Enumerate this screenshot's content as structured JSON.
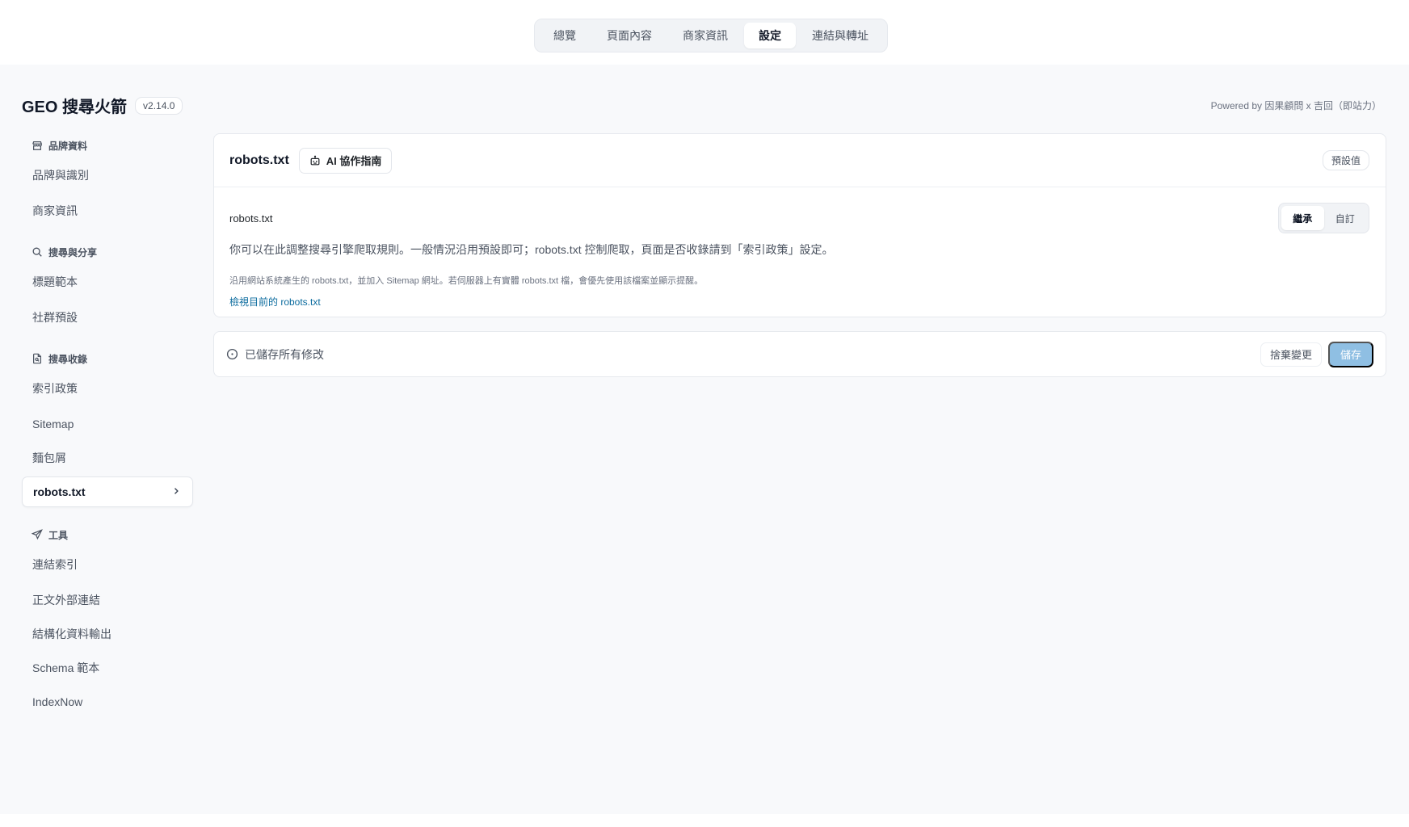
{
  "top_tabs": [
    {
      "label": "總覽"
    },
    {
      "label": "頁面內容"
    },
    {
      "label": "商家資訊"
    },
    {
      "label": "設定",
      "active": true
    },
    {
      "label": "連結與轉址"
    }
  ],
  "brand": {
    "title": "GEO 搜尋火箭",
    "version": "v2.14.0"
  },
  "powered_by": "Powered by 因果顧問 x 吉回（即站力）",
  "sidebar": {
    "groups": [
      {
        "label": "品牌資料",
        "icon": "store-icon",
        "items": [
          {
            "label": "品牌與識別"
          },
          {
            "label": "商家資訊"
          }
        ]
      },
      {
        "label": "搜尋與分享",
        "icon": "search-icon",
        "items": [
          {
            "label": "標題範本"
          },
          {
            "label": "社群預設"
          }
        ]
      },
      {
        "label": "搜尋收錄",
        "icon": "file-search-icon",
        "items": [
          {
            "label": "索引政策"
          },
          {
            "label": "Sitemap"
          },
          {
            "label": "麵包屑"
          },
          {
            "label": "robots.txt",
            "active": true
          }
        ]
      },
      {
        "label": "工具",
        "icon": "send-icon",
        "items": [
          {
            "label": "連結索引"
          },
          {
            "label": "正文外部連結"
          },
          {
            "label": "結構化資料輸出"
          },
          {
            "label": "Schema 範本"
          },
          {
            "label": "IndexNow"
          }
        ]
      }
    ]
  },
  "main": {
    "title": "robots.txt",
    "ai_button": "AI 協作指南",
    "default_badge": "預設值",
    "field_label": "robots.txt",
    "segment": {
      "inherit": "繼承",
      "custom": "自訂",
      "selected": "繼承"
    },
    "description": "你可以在此調整搜尋引擎爬取規則。一般情況沿用預設即可；robots.txt 控制爬取，頁面是否收錄請到「索引政策」設定。",
    "hint": "沿用網站系統產生的 robots.txt，並加入 Sitemap 網址。若伺服器上有實體 robots.txt 檔，會優先使用該檔案並顯示提醒。",
    "link": "檢視目前的 robots.txt"
  },
  "save_bar": {
    "status": "已儲存所有修改",
    "discard": "捨棄變更",
    "save": "儲存"
  }
}
